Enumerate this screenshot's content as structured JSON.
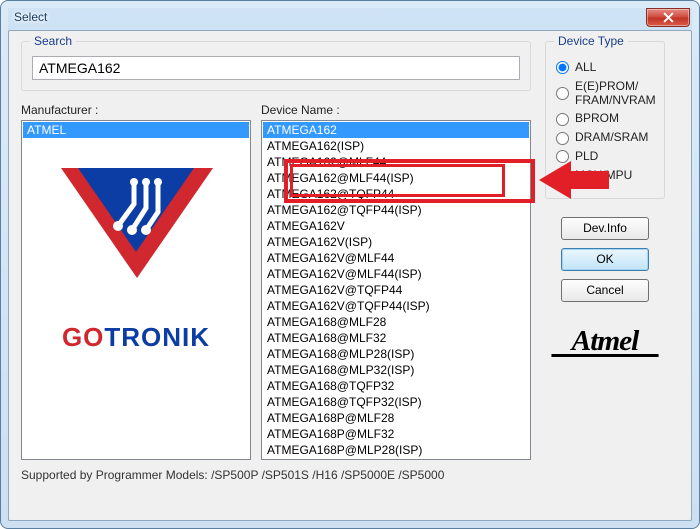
{
  "window": {
    "title": "Select"
  },
  "search": {
    "legend": "Search",
    "value": "ATMEGA162"
  },
  "manufacturer": {
    "label": "Manufacturer :",
    "items": [
      "ATMEL"
    ],
    "selected_index": 0
  },
  "device": {
    "label": "Device Name :",
    "selected_index": 0,
    "items": [
      "ATMEGA162",
      "ATMEGA162(ISP)",
      "ATMEGA162@MLF44",
      "ATMEGA162@MLF44(ISP)",
      "ATMEGA162@TQFP44",
      "ATMEGA162@TQFP44(ISP)",
      "ATMEGA162V",
      "ATMEGA162V(ISP)",
      "ATMEGA162V@MLF44",
      "ATMEGA162V@MLF44(ISP)",
      "ATMEGA162V@TQFP44",
      "ATMEGA162V@TQFP44(ISP)",
      "ATMEGA168@MLF28",
      "ATMEGA168@MLF32",
      "ATMEGA168@MLP28(ISP)",
      "ATMEGA168@MLP32(ISP)",
      "ATMEGA168@TQFP32",
      "ATMEGA168@TQFP32(ISP)",
      "ATMEGA168P@MLF28",
      "ATMEGA168P@MLF32",
      "ATMEGA168P@MLP28(ISP)"
    ]
  },
  "device_type": {
    "legend": "Device Type",
    "selected": "ALL",
    "options": [
      {
        "id": "ALL",
        "label": "ALL"
      },
      {
        "id": "EEPROM",
        "label": "E(E)PROM/\nFRAM/NVRAM"
      },
      {
        "id": "BPROM",
        "label": "BPROM"
      },
      {
        "id": "DRAM",
        "label": "DRAM/SRAM"
      },
      {
        "id": "PLD",
        "label": "PLD"
      },
      {
        "id": "MCU",
        "label": "MCU/MPU"
      }
    ]
  },
  "buttons": {
    "dev_info": "Dev.Info",
    "ok": "OK",
    "cancel": "Cancel"
  },
  "side_logo": {
    "brand_go": "GO",
    "brand_tronik": "TRONIK"
  },
  "vendor_logo": "Atmel",
  "footer": "Supported by Programmer Models: /SP500P /SP501S /H16 /SP5000E /SP5000",
  "colors": {
    "accent_select": "#3399ff",
    "annotation": "#e21f26"
  }
}
